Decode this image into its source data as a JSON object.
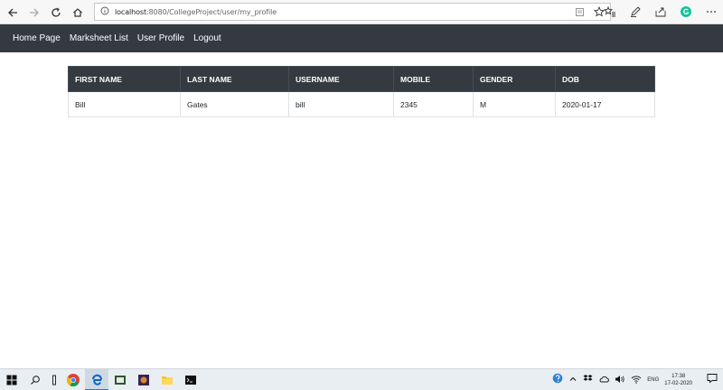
{
  "browser": {
    "url_host": "localhost",
    "url_rest": ":8080/CollegeProject/user/my_profile"
  },
  "navbar": {
    "items": [
      {
        "label": "Home Page"
      },
      {
        "label": "Marksheet List"
      },
      {
        "label": "User Profile"
      },
      {
        "label": "Logout"
      }
    ]
  },
  "profile_table": {
    "headers": [
      "FIRST NAME",
      "LAST NAME",
      "USERNAME",
      "MOBILE",
      "GENDER",
      "DOB"
    ],
    "rows": [
      [
        "Bill",
        "Gates",
        "bill",
        "2345",
        "M",
        "2020-01-17"
      ]
    ]
  },
  "taskbar": {
    "lang": "ENG",
    "time": "17:38",
    "date": "17-02-2020"
  }
}
